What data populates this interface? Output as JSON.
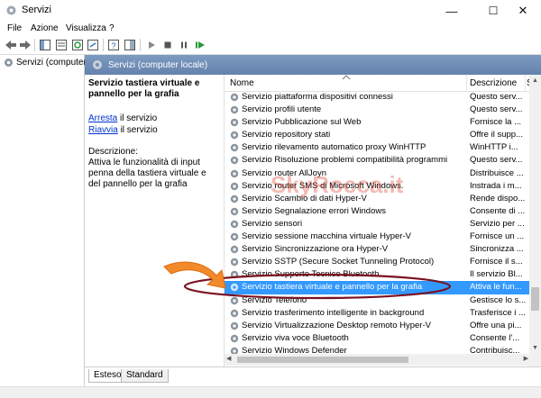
{
  "window": {
    "title": "Servizi",
    "minimize_glyph": "—",
    "maximize_glyph": "☐",
    "close_glyph": "✕"
  },
  "menu": [
    "File",
    "Azione",
    "Visualizza",
    "?"
  ],
  "tree": {
    "item": "Servizi (computer"
  },
  "main_header": "Servizi (computer locale)",
  "extended": {
    "service_name": "Servizio tastiera virtuale e pannello per la grafia",
    "stop_link": "Arresta",
    "stop_rest": " il servizio",
    "restart_link": "Riavvia",
    "restart_rest": " il servizio",
    "desc_label": "Descrizione:",
    "desc_text": "Attiva le funzionalità di input penna della tastiera virtuale e del pannello per la grafia"
  },
  "columns": {
    "name": "Nome",
    "description": "Descrizione",
    "status": "S"
  },
  "rows": [
    {
      "name": "Servizio piattaforma dispositivi connessi",
      "desc": "Questo serv..."
    },
    {
      "name": "Servizio profili utente",
      "desc": "Questo serv..."
    },
    {
      "name": "Servizio Pubblicazione sul Web",
      "desc": "Fornisce la ..."
    },
    {
      "name": "Servizio repository stati",
      "desc": "Offre il supp..."
    },
    {
      "name": "Servizio rilevamento automatico proxy WinHTTP",
      "desc": "WinHTTP i..."
    },
    {
      "name": "Servizio Risoluzione problemi compatibilità programmi",
      "desc": "Questo serv..."
    },
    {
      "name": "Servizio router AllJoyn",
      "desc": "Distribuisce ..."
    },
    {
      "name": "Servizio router SMS di Microsoft Windows.",
      "desc": "Instrada i m..."
    },
    {
      "name": "Servizio Scambio di dati Hyper-V",
      "desc": "Rende dispo..."
    },
    {
      "name": "Servizio Segnalazione errori Windows",
      "desc": "Consente di ..."
    },
    {
      "name": "Servizio sensori",
      "desc": "Servizio per ..."
    },
    {
      "name": "Servizio sessione macchina virtuale Hyper-V",
      "desc": "Fornisce un ..."
    },
    {
      "name": "Servizio Sincronizzazione ora Hyper-V",
      "desc": "Sincronizza ..."
    },
    {
      "name": "Servizio SSTP (Secure Socket Tunneling Protocol)",
      "desc": "Fornisce il s..."
    },
    {
      "name": "Servizio Supporto Tecnico Bluetooth",
      "desc": "Il servizio Bl..."
    },
    {
      "name": "Servizio tastiera virtuale e pannello per la grafia",
      "desc": "Attiva le fun...",
      "selected": true
    },
    {
      "name": "Servizio Telefono",
      "desc": "Gestisce lo s..."
    },
    {
      "name": "Servizio trasferimento intelligente in background",
      "desc": "Trasferisce i ..."
    },
    {
      "name": "Servizio Virtualizzazione Desktop remoto Hyper-V",
      "desc": "Offre una pi..."
    },
    {
      "name": "Servizio viva voce Bluetooth",
      "desc": "Consente l'..."
    },
    {
      "name": "Servizio Windows Defender",
      "desc": "Contribuisc..."
    }
  ],
  "tabs": [
    "Esteso",
    "Standard"
  ],
  "watermark": "SkyRocca.it",
  "colors": {
    "header_bar": "#6f8fb5",
    "selection": "#3399ff",
    "link": "#0033cc",
    "annotation": "#7a1020",
    "arrow": "#f28a2a"
  },
  "icons": [
    "services-app-icon",
    "back-icon",
    "forward-icon",
    "console-tree-icon",
    "properties-icon",
    "refresh-icon",
    "export-icon",
    "help-icon",
    "show-hide-icon",
    "play-icon",
    "stop-icon",
    "pause-icon",
    "restart-icon",
    "gear-icon"
  ]
}
